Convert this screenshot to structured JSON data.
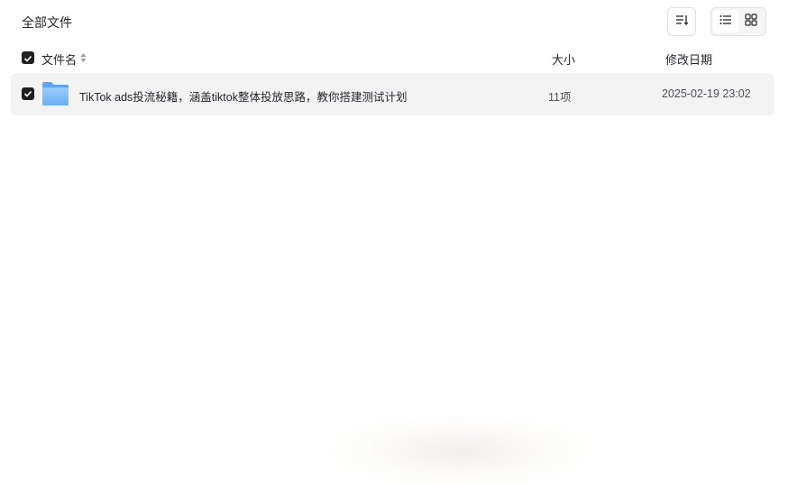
{
  "header": {
    "title": "全部文件"
  },
  "toolbar": {
    "sort_icon": "sort-list-icon",
    "view_options": [
      {
        "name": "list-view",
        "icon": "list-icon",
        "active": true
      },
      {
        "name": "grid-view",
        "icon": "grid-icon",
        "active": false
      }
    ]
  },
  "columns": {
    "name": "文件名",
    "size": "大小",
    "date": "修改日期"
  },
  "files": [
    {
      "name": "TikTok ads投流秘籍，涵盖tiktok整体投放思路，教你搭建测试计划",
      "size": "11项",
      "date": "2025-02-19 23:02",
      "type": "folder",
      "selected": true
    }
  ],
  "colors": {
    "row_bg": "#f3f3f4",
    "checkbox": "#1f1f1f",
    "folder": "#7fb8f5"
  }
}
